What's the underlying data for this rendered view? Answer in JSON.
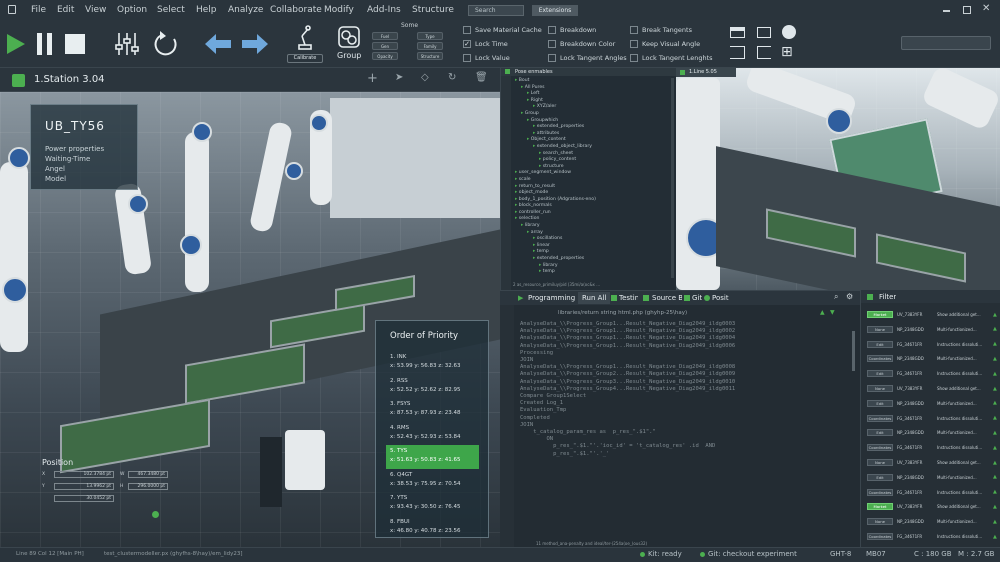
{
  "menu": [
    "File",
    "Edit",
    "View",
    "Option",
    "Select",
    "Help",
    "Analyze",
    "Collaborate",
    "Modify",
    "Add-Ins",
    "Structure"
  ],
  "menu_search": "Search",
  "menu_extensions": "Extensions",
  "toolbar": {
    "calibrate_label": "Calibrate",
    "group_label": "Group",
    "some_label": "Some",
    "some_buttons": [
      "Fuel",
      "Type",
      "Gen",
      "Family",
      "Opacity",
      "Structure"
    ],
    "checks": [
      {
        "label": "Save Material Cache",
        "checked": false
      },
      {
        "label": "Breakdown",
        "checked": false
      },
      {
        "label": "Break Tangents",
        "checked": false
      },
      {
        "label": "Lock Time",
        "checked": true
      },
      {
        "label": "Breakdown Color",
        "checked": false
      },
      {
        "label": "Keep Visual Angle",
        "checked": false
      },
      {
        "label": "Lock Value",
        "checked": false
      },
      {
        "label": "Lock Tangent Angles",
        "checked": false
      },
      {
        "label": "Lock Tangent Lenghts",
        "checked": false
      }
    ]
  },
  "left_tab": {
    "title": "1.Station 3.04"
  },
  "overlay": {
    "title": "UB_TY56",
    "lines": [
      "Power properties",
      "Waiting-Time",
      "Angel",
      "Model"
    ]
  },
  "position": {
    "title": "Position",
    "rows": [
      {
        "a": "X",
        "av": "102.3784 pt",
        "b": "W",
        "bv": "467.3480 pt"
      },
      {
        "a": "Y",
        "av": "13.9962 pt",
        "b": "H",
        "bv": "296.0000 pt"
      },
      {
        "a": "",
        "av": "30.0452 pt",
        "b": "",
        "bv": ""
      }
    ]
  },
  "priority": {
    "title": "Order of Priority",
    "items": [
      {
        "name": "1. INK",
        "val": "x: 53.99 y: 56.83 z: 32.63",
        "selected": false
      },
      {
        "name": "2. RSS",
        "val": "x: 52.52 y: 52.62 z: 82.95",
        "selected": false
      },
      {
        "name": "3. FSYS",
        "val": "x: 87.53 y: 87.93 z: 23.48",
        "selected": false
      },
      {
        "name": "4. RMS",
        "val": "x: 52.43 y: 52.93 z: 53.84",
        "selected": false
      },
      {
        "name": "5. TYS",
        "val": "x: 51.63 y: 50.83 z: 41.65",
        "selected": true
      },
      {
        "name": "6. Q4GT",
        "val": "x: 38.53 y: 75.95 z: 70.54",
        "selected": false
      },
      {
        "name": "7. YTS",
        "val": "x: 93.43 y: 30.50 z: 76.45",
        "selected": false
      },
      {
        "name": "8. FBUI",
        "val": "x: 46.80 y: 40.78 z: 23.56",
        "selected": false
      }
    ]
  },
  "tree": {
    "title": "Pose enmables",
    "items": [
      "Bout",
      "All Pures",
      "Left",
      "Right",
      "XYZ/aler",
      "Group",
      "Groupwhich",
      "extended_properties",
      "attributes",
      "Object_content",
      "extended_object_library",
      "search_sheet",
      "policy_content",
      "structure",
      "user_segment_window",
      "scale",
      "return_to_result",
      "object_mode",
      "body_1_position (Adgrations-eno)",
      "block_normals",
      "controller_run",
      "selection",
      "library",
      "array",
      "oscillations",
      "linear",
      "temp",
      "extended_properties",
      "library",
      "temp"
    ],
    "footer": "2 as_resource_primiluy/pid (35mi/a(oc&x ..."
  },
  "right_tab": {
    "title": "1.Line 5.05"
  },
  "programming": {
    "tabs": [
      "Programming",
      "Run All",
      "Testing",
      "Source Br",
      "Git",
      "Posit"
    ],
    "file": "libraries/return string html.php (ghyhp-25\\hay)",
    "lines": [
      "AnalyseData_\\\\Progress_Group1...Result_Negative_Diag2049_ildg0003",
      "AnalyseData_\\\\Progress_Group1...Result_Negative_Diag2049_ildg0002",
      "AnalyseData_\\\\Progress_Group1...Result_Negative_Diag2049_ildg0004",
      "AnalyseData_\\\\Progress_Group1...Result_Negative_Diag2049_ildg0006",
      "",
      "Processing",
      "JOIN",
      "AnalyseData_\\\\Progress_Group1...Result_Negative_Diag2049_ildg0008",
      "AnalyseData_\\\\Progress_Group2...Result_Negative_Diag2049_ildg0009",
      "AnalyseData_\\\\Progress_Group3...Result_Negative_Diag2049_ildg0010",
      "AnalyseData_\\\\Progress_Group4...Result_Negative_Diag2049_ildg0011",
      "",
      "Compare Group1Select",
      "Created Log_1",
      "Evaluation_Tmp",
      "Completed",
      "JOIN",
      "    t_catalog_param_res as  p_res_\".$1\".\"",
      "        ON",
      "          p_res_\".$1.\"'.'ioc_id' = 't_catalog_res' .id  AND",
      "          p_res_\".$1.\"'.'_'"
    ],
    "footer": "11 method_ana-penalty and ideal/ter-(254a(oe_(ous32)"
  },
  "filter": {
    "title": "Filter",
    "rows": [
      {
        "btn": "Market",
        "on": true,
        "code": "UV_7383YFR",
        "desc": "Show additional get..."
      },
      {
        "btn": "None",
        "on": false,
        "code": "NP_2348GDD",
        "desc": "Multi-functionized..."
      },
      {
        "btn": "Edit",
        "on": false,
        "code": "FG_34671FR",
        "desc": "Instructions dissoluti..."
      },
      {
        "btn": "Coordinates",
        "on": false,
        "code": "NP_2348GDD",
        "desc": "Multi-functionized..."
      },
      {
        "btn": "Edit",
        "on": false,
        "code": "FG_34671FR",
        "desc": "Instructions dissoluti..."
      },
      {
        "btn": "None",
        "on": false,
        "code": "UV_7383YFR",
        "desc": "Show additional get..."
      },
      {
        "btn": "Edit",
        "on": false,
        "code": "NP_2348GDD",
        "desc": "Multi-functionized..."
      },
      {
        "btn": "Coordinates",
        "on": false,
        "code": "FG_34671FR",
        "desc": "Instructions dissoluti..."
      },
      {
        "btn": "Edit",
        "on": false,
        "code": "NP_2348GDD",
        "desc": "Multi-functionized..."
      },
      {
        "btn": "Coordinates",
        "on": false,
        "code": "FG_34671FR",
        "desc": "Instructions dissoluti..."
      },
      {
        "btn": "None",
        "on": false,
        "code": "UV_7383YFR",
        "desc": "Show additional get..."
      },
      {
        "btn": "Edit",
        "on": false,
        "code": "NP_2348GDD",
        "desc": "Multi-functionized..."
      },
      {
        "btn": "Coordinates",
        "on": false,
        "code": "FG_34671FR",
        "desc": "Instructions dissoluti..."
      },
      {
        "btn": "Market",
        "on": true,
        "code": "UV_7383YFR",
        "desc": "Show additional get..."
      },
      {
        "btn": "None",
        "on": false,
        "code": "NP_2348GDD",
        "desc": "Multi-functionized..."
      },
      {
        "btn": "Coordinates",
        "on": false,
        "code": "FG_34671FR",
        "desc": "Instructions dissoluti..."
      }
    ]
  },
  "status": {
    "left": "Line 89 Col 12 [Main PH]",
    "file": "test_clustermodeller.px (ghyfhs-8\\hay)/em_lidy23]",
    "kit": "Kit: ready",
    "git": "Git: checkout experiment",
    "ghts": "GHT-8",
    "mb": "MB07",
    "c": "C : 180 GB",
    "m": "M : 2.7 GB"
  },
  "colors": {
    "accent": "#4caf50",
    "panel": "#232d35",
    "text": "#cfd8dc"
  }
}
